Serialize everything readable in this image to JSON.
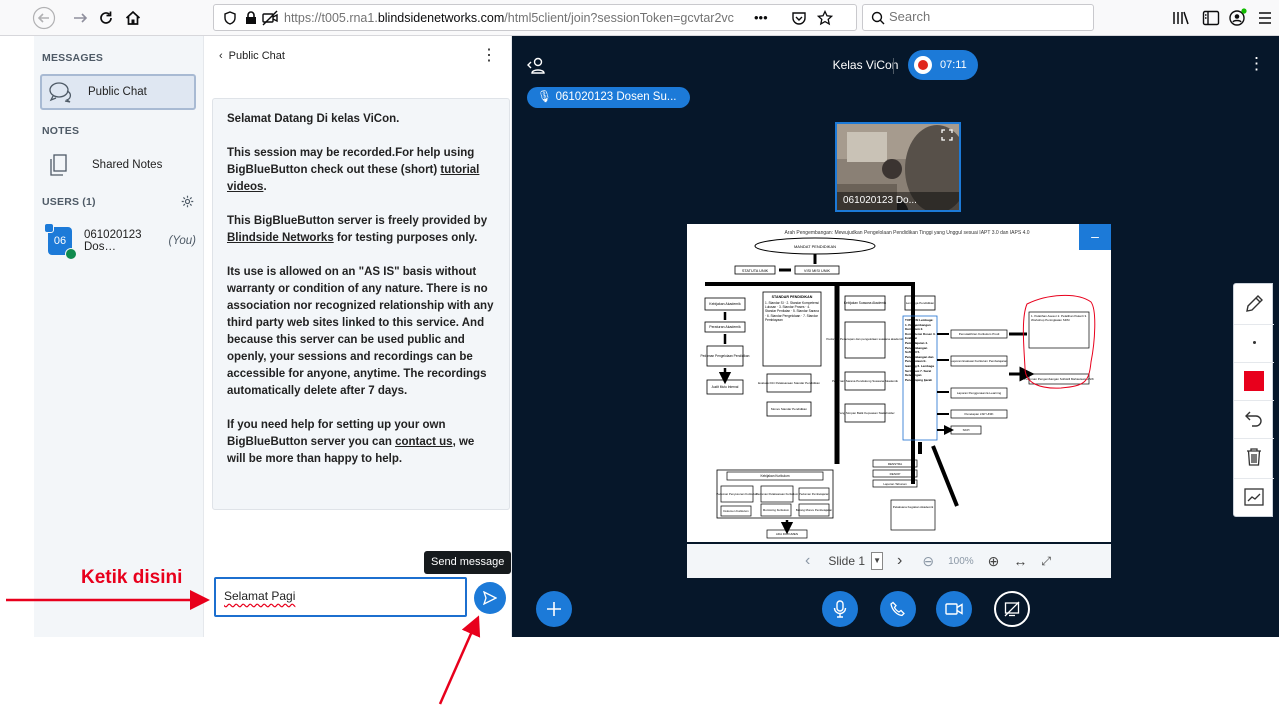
{
  "browser": {
    "url_prefix": "https://t005.rna1.",
    "url_domain": "blindsidenetworks.com",
    "url_suffix": "/html5client/join?sessionToken=gcvtar2vc",
    "url_more": "•••",
    "search_placeholder": "Search"
  },
  "userlist": {
    "messages_title": "MESSAGES",
    "public_chat": "Public Chat",
    "notes_title": "NOTES",
    "shared_notes": "Shared Notes",
    "users_title": "USERS (1)",
    "user_avatar": "06",
    "user_name": "061020123 Dos…",
    "user_you": "(You)"
  },
  "chat": {
    "header": "Public Chat",
    "welcome_1": "Selamat Datang Di kelas ViCon.",
    "welcome_2a": "This session may be recorded.For help using BigBlueButton check out these (short) ",
    "welcome_2_link": "tutorial videos",
    "welcome_2b": ".",
    "welcome_3a": "This BigBlueButton server is freely provided by ",
    "welcome_3_link": "Blindside Networks",
    "welcome_3b": " for testing purposes only.",
    "welcome_4": "Its use is allowed on an \"AS IS\" basis without warranty or condition of any nature. There is no association nor recognized relationship with any third party web sites linked to this service. And because this server can be used public and openly, your sessions and recordings can be accessible for anyone, anytime. The recordings automatically delete after 7 days.",
    "welcome_5a": "If you need help for setting up your own BigBlueButton server you can ",
    "welcome_5_link": "contact us",
    "welcome_5b": ", we will be more than happy to help.",
    "input_value": "Selamat Pagi",
    "send_tooltip": "Send message"
  },
  "main": {
    "room_title": "Kelas ViCon",
    "rec_time": "07:11",
    "talker": "061020123 Dosen Su...",
    "webcam_name": "061020123 Do...",
    "slide_label": "Slide 1",
    "zoom": "100%"
  },
  "slide": {
    "title": "Arah Pengembangan: Mewujudkan Pengelolaan Pendidikan Tinggi yang Unggul sesuai IAPT 3.0 dan IAPS 4.0",
    "top": "MANDAT PENDIDIKAN",
    "statuta": "STATUTA UNIK",
    "visi": "VISI MISI UNIK",
    "left_boxes": [
      "Kebijakan Akademik",
      "Peraturan Akademik",
      "Pedoman Pengelolaan Pendidikan",
      "Audit Mutu Internal"
    ],
    "standar_title": "STANDAR PENDIDIKAN",
    "standar_items": "1. Standar SI · 2. Standar Kompetensi Lulusan · 3. Standar Proses · 4. Standar Penilaian · 5. Standar Sarana · 6. Standar Pengelolaan · 7. Standar Pembiayaan",
    "evaluasi": "Evaluasi Diri Pelaksanaan Standar Pendidikan",
    "monev": "Monev Standar Pendidikan",
    "kebijakan_suasana": "Kebijakan Suasana Akademik",
    "pedoman_suasana": "Pedoman Penerapan dan pengelolaan suasana akademik",
    "sarana": "Pedoman Sarana Pendukung Suasana Akademik",
    "barang": "Barang Simpan Balik Kepuasan Stakeholder",
    "lembaga": "Lembaga Pendidikan",
    "tupoksi": "TUPOKSI Lembaga: 1. Pengembangan Kurikulum 2. Kompetensi Dosen 3. Evaluasi Pembelajaran 4. Pengembangan Softskill 5. Pengembangan dan Pengelolaan E-learning 6. Lembaga Sertifikasi 7. Surat Keterangan Pendamping Ijazah",
    "right_box_1": "Pemutakhiran Kurikulum Prodi",
    "right_box_2": "Laporan Evaluasi Kurikulum Pembelajaran",
    "right_box_3": "Laporan Penggunaan E-Learning",
    "right_box_4": "Penetapan LSP UNIK",
    "right_box_5": "SKPI",
    "far_box_1": "1. Pelatihan Asesor 2. Pelatihan Pekerti 3. Workshop Peningkatan SDM",
    "far_box_2": "Pedoman Pengembangan Softskill Mahasiswa UNIK",
    "renstra": "RENSTRA",
    "renop": "RENOP",
    "laporan": "Laporan Tahunan",
    "pelaksana": "Pelaksana Kegiatan Akademik",
    "kebijakan_kurikulum": "Kebijakan Kurikulum",
    "pedoman_kur_1": "Pedoman Penyusunan Kurikulum",
    "pedoman_kur_2": "Pedoman Pelaksanaan Kurikulum",
    "pedoman_kur_3": "Pedoman Pembelajaran",
    "dokumen": "Dokumen Kurikulum",
    "monitoring": "Monitoring Kurikulum",
    "barang_monev": "Barang Monev Pembelajaran",
    "ada_dokumen": "ADA DOKUMEN"
  },
  "annotation": {
    "label": "Ketik disini"
  },
  "colors": {
    "accent": "#1c7ad8",
    "dark_bg": "#06172a",
    "annotation_red": "#e8001c",
    "record": "#e0261c"
  }
}
